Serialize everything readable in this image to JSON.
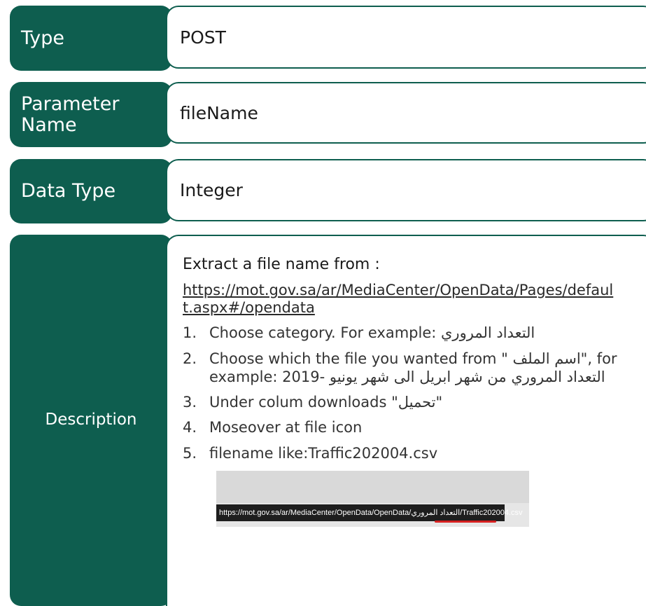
{
  "rows": {
    "type": {
      "label": "Type",
      "value": "POST"
    },
    "parameter_name": {
      "label": "Parameter Name",
      "value": "fileName"
    },
    "data_type": {
      "label": "Data Type",
      "value": "Integer"
    },
    "description": {
      "label": "Description",
      "heading": "Extract a file name from :",
      "link": "https://mot.gov.sa/ar/MediaCenter/OpenData/Pages/default.aspx#/opendata",
      "steps": [
        {
          "num": "1.",
          "text": "Choose category. For example: التعداد المروري"
        },
        {
          "num": "2.",
          "text": "Choose which the file you wanted from \" اسم الملف\", for example: التعداد المروري من شهر ابريل الى شهر يونيو -2019"
        },
        {
          "num": "3.",
          "text": "Under colum downloads \"تحميل\""
        },
        {
          "num": "4.",
          "text": "Moseover at file icon"
        },
        {
          "num": "5.",
          "text": "filename like:Traffic202004.csv"
        }
      ],
      "screenshot_url": "https://mot.gov.sa/ar/MediaCenter/OpenData/OpenData/التعداد المروري/Traffic202004.csv"
    }
  }
}
